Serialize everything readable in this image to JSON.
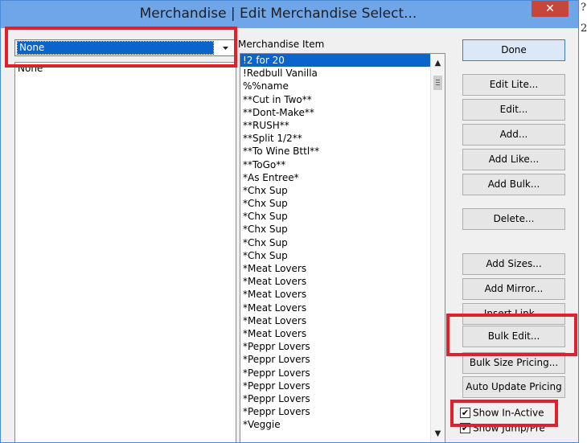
{
  "window": {
    "title": "Merchandise | Edit Merchandise Select...",
    "close_glyph": "✕"
  },
  "filter": {
    "selected": "None",
    "options": [
      "None"
    ]
  },
  "merch_list": {
    "header": "Merchandise Item",
    "items": [
      "!2 for 20",
      "!Redbull Vanilla",
      "%%name",
      "**Cut in Two**",
      "**Dont-Make**",
      "**RUSH**",
      "**Split 1/2**",
      "**To Wine Bttl**",
      "**ToGo**",
      "*As Entree*",
      "*Chx Sup",
      "*Chx Sup",
      "*Chx Sup",
      "*Chx Sup",
      "*Chx Sup",
      "*Chx Sup",
      "*Meat Lovers",
      "*Meat Lovers",
      "*Meat Lovers",
      "*Meat Lovers",
      "*Meat Lovers",
      "*Meat Lovers",
      "*Peppr Lovers",
      "*Peppr Lovers",
      "*Peppr Lovers",
      "*Peppr Lovers",
      "*Peppr Lovers",
      "*Peppr Lovers",
      "*Veggie"
    ],
    "selected_index": 0
  },
  "buttons": {
    "done": "Done",
    "edit_lite": "Edit Lite...",
    "edit": "Edit...",
    "add": "Add...",
    "add_like": "Add Like...",
    "add_bulk": "Add Bulk...",
    "delete": "Delete...",
    "add_sizes": "Add Sizes...",
    "add_mirror": "Add Mirror...",
    "insert_link": "Insert Link...",
    "bulk_edit": "Bulk Edit...",
    "bulk_size_pricing": "Bulk Size Pricing...",
    "auto_update_pricing": "Auto Update Pricing"
  },
  "checks": {
    "show_inactive": {
      "label": "Show In-Active",
      "checked": true
    },
    "show_jump": {
      "label": "Show Jump/Pre",
      "checked": true
    }
  },
  "edge_glyphs": [
    "?",
    "2"
  ],
  "colors": {
    "highlight": "#e0202a",
    "selection": "#0a64cc",
    "titlebar": "#6fa6ea",
    "close": "#c7463a"
  }
}
